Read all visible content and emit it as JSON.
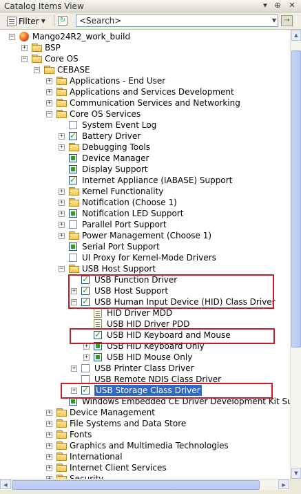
{
  "window": {
    "title": "Catalog Items View",
    "pin_glyph": "▾",
    "autohide_glyph": "⊕",
    "close_glyph": "✕"
  },
  "toolbar": {
    "filter_label": "Filter",
    "search_value": "<Search>",
    "go_glyph": "→",
    "refresh_glyph": "↻"
  },
  "tree": [
    {
      "label": "Mango24R2_work_build",
      "icon": "globe-icon",
      "exp": "−"
    },
    {
      "label": "BSP",
      "icon": "folder-icon",
      "exp": "+"
    },
    {
      "label": "Core OS",
      "icon": "folder-icon",
      "exp": "−"
    },
    {
      "label": "CEBASE",
      "icon": "folder-icon",
      "exp": "−"
    },
    {
      "label": "Applications - End User",
      "icon": "folder-icon",
      "exp": "+"
    },
    {
      "label": "Applications and Services Development",
      "icon": "folder-icon",
      "exp": "+"
    },
    {
      "label": "Communication Services and Networking",
      "icon": "folder-icon",
      "exp": "+"
    },
    {
      "label": "Core OS Services",
      "icon": "folder-icon",
      "exp": "−"
    },
    {
      "label": "System Event Log",
      "check": "empty"
    },
    {
      "label": "Battery Driver",
      "check": "checked",
      "exp": "+"
    },
    {
      "label": "Debugging Tools",
      "icon": "folder-icon",
      "exp": "+"
    },
    {
      "label": "Device Manager",
      "check": "filled"
    },
    {
      "label": "Display Support",
      "check": "filled"
    },
    {
      "label": "Internet Appliance (IABASE) Support",
      "check": "checked"
    },
    {
      "label": "Kernel Functionality",
      "icon": "folder-icon",
      "exp": "+"
    },
    {
      "label": "Notification (Choose 1)",
      "icon": "folder-icon",
      "exp": "+"
    },
    {
      "label": "Notification LED Support",
      "check": "filled",
      "exp": "+"
    },
    {
      "label": "Parallel Port Support",
      "check": "empty",
      "exp": "+"
    },
    {
      "label": "Power Management (Choose 1)",
      "icon": "folder-icon",
      "exp": "+"
    },
    {
      "label": "Serial Port Support",
      "check": "filled"
    },
    {
      "label": "UI Proxy for Kernel-Mode Drivers",
      "check": "empty"
    },
    {
      "label": "USB Host Support",
      "icon": "folder-icon",
      "exp": "−"
    },
    {
      "label": "USB Function Driver",
      "check": "checked"
    },
    {
      "label": "USB Host Support",
      "check": "checked",
      "exp": "+"
    },
    {
      "label": "USB Human Input Device (HID) Class Driver",
      "check": "checked",
      "exp": "−"
    },
    {
      "label": "HID Driver MDD",
      "icon": "doc-icon"
    },
    {
      "label": "USB HID Driver PDD",
      "icon": "doc-icon"
    },
    {
      "label": "USB HID Keyboard and Mouse",
      "check": "checked"
    },
    {
      "label": "USB HID Keyboard Only",
      "check": "filled",
      "exp": "+"
    },
    {
      "label": "USB HID Mouse Only",
      "check": "filled",
      "exp": "+"
    },
    {
      "label": "USB Printer Class Driver",
      "check": "empty",
      "exp": "+"
    },
    {
      "label": "USB Remote NDIS Class Driver",
      "check": "empty"
    },
    {
      "label": "USB Storage Class Driver",
      "check": "checked",
      "exp": "+",
      "selected": true
    },
    {
      "label": "Windows Embedded CE Driver Development Kit Su",
      "check": "filled"
    },
    {
      "label": "Device Management",
      "icon": "folder-icon",
      "exp": "+"
    },
    {
      "label": "File Systems and Data Store",
      "icon": "folder-icon",
      "exp": "+"
    },
    {
      "label": "Fonts",
      "icon": "folder-icon",
      "exp": "+"
    },
    {
      "label": "Graphics and Multimedia Technologies",
      "icon": "folder-icon",
      "exp": "+"
    },
    {
      "label": "International",
      "icon": "folder-icon",
      "exp": "+"
    },
    {
      "label": "Internet Client Services",
      "icon": "folder-icon",
      "exp": "+"
    },
    {
      "label": "Security",
      "icon": "folder-icon",
      "exp": "+"
    }
  ]
}
